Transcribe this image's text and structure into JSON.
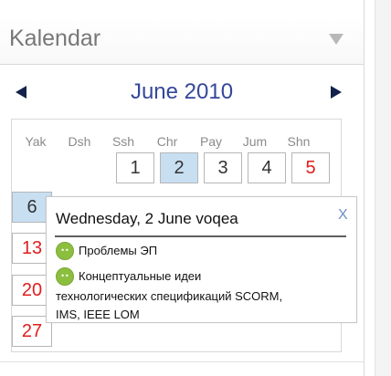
{
  "block": {
    "title": "Kalendar",
    "collapse_icon": "collapse-triangle-icon"
  },
  "calendar": {
    "month_label": "June 2010",
    "prev_icon": "previous-arrow-icon",
    "next_icon": "next-arrow-icon",
    "weekdays": [
      "Yak",
      "Dsh",
      "Ssh",
      "Chr",
      "Pay",
      "Jum",
      "Shn"
    ],
    "days": {
      "d1": "1",
      "d2": "2",
      "d3": "3",
      "d4": "4",
      "d5": "5",
      "d6": "6",
      "d13": "13",
      "d20": "20",
      "d27": "27"
    },
    "selected_day": "2",
    "selected_color": "#c8dff2",
    "weekend_color": "#e11d1d"
  },
  "popup": {
    "title": "Wednesday, 2 June voqea",
    "close_label": "X",
    "events": [
      {
        "icon": "event-icon",
        "icon_label": "••",
        "text": "Проблемы ЭП"
      },
      {
        "icon": "event-icon",
        "icon_label": "••",
        "text": "Концептуальные идеи",
        "continuation": [
          "технологических спецификаций SCORM,",
          "IMS, IEEE LOM"
        ]
      }
    ]
  },
  "colors": {
    "accent": "#34479a",
    "header_text": "#777777",
    "event_icon": "#8dbf3f",
    "close_icon": "#6f8dc7"
  }
}
